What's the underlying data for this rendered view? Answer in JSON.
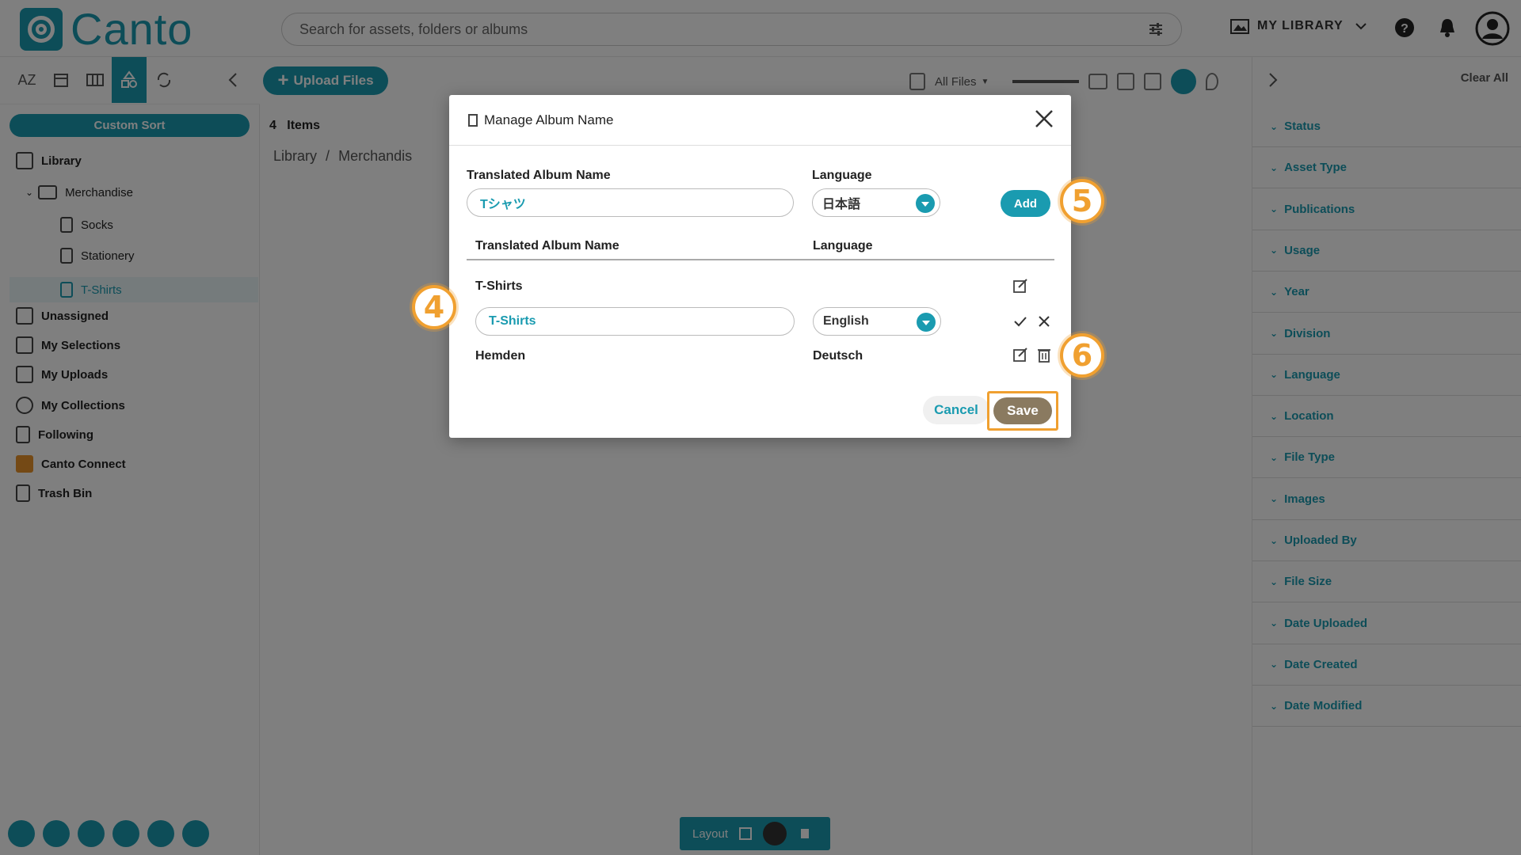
{
  "header": {
    "logo_text": "Canto",
    "search_placeholder": "Search for assets, folders or albums",
    "library_label": "MY LIBRARY"
  },
  "toolbar": {
    "az_label": "AZ",
    "upload_label": "Upload Files",
    "all_files_label": "All Files"
  },
  "sidebar": {
    "custom_sort": "Custom Sort",
    "library": "Library",
    "merchandise": "Merchandise",
    "socks": "Socks",
    "stationery": "Stationery",
    "tshirts": "T-Shirts",
    "unassigned": "Unassigned",
    "my_selections": "My Selections",
    "my_uploads": "My Uploads",
    "my_collections": "My Collections",
    "following": "Following",
    "canto_connect": "Canto Connect",
    "trash_bin": "Trash Bin"
  },
  "main": {
    "items_count": "4",
    "items_label": "Items",
    "breadcrumb_library": "Library",
    "breadcrumb_sep": "/",
    "breadcrumb_merch": "Merchandis",
    "layout_label": "Layout"
  },
  "filters": {
    "clear_all": "Clear All",
    "items": [
      "Status",
      "Asset Type",
      "Publications",
      "Usage",
      "Year",
      "Division",
      "Language",
      "Location",
      "File Type",
      "Images",
      "Uploaded By",
      "File Size",
      "Date Uploaded",
      "Date Created",
      "Date Modified"
    ]
  },
  "modal": {
    "title": "Manage Album Name",
    "new_name_label": "Translated Album Name",
    "new_name_value": "Tシャツ",
    "language_label": "Language",
    "new_language_value": "日本語",
    "add_label": "Add",
    "col_name": "Translated Album Name",
    "col_language": "Language",
    "row1_name": "T-Shirts",
    "edit_name_value": "T-Shirts",
    "edit_language_value": "English",
    "row2_name": "Hemden",
    "row2_language": "Deutsch",
    "cancel_label": "Cancel",
    "save_label": "Save"
  },
  "callouts": {
    "c4": "4",
    "c5": "5",
    "c6": "6"
  },
  "colors": {
    "accent": "#1a9bb0",
    "callout": "#f0a030"
  }
}
